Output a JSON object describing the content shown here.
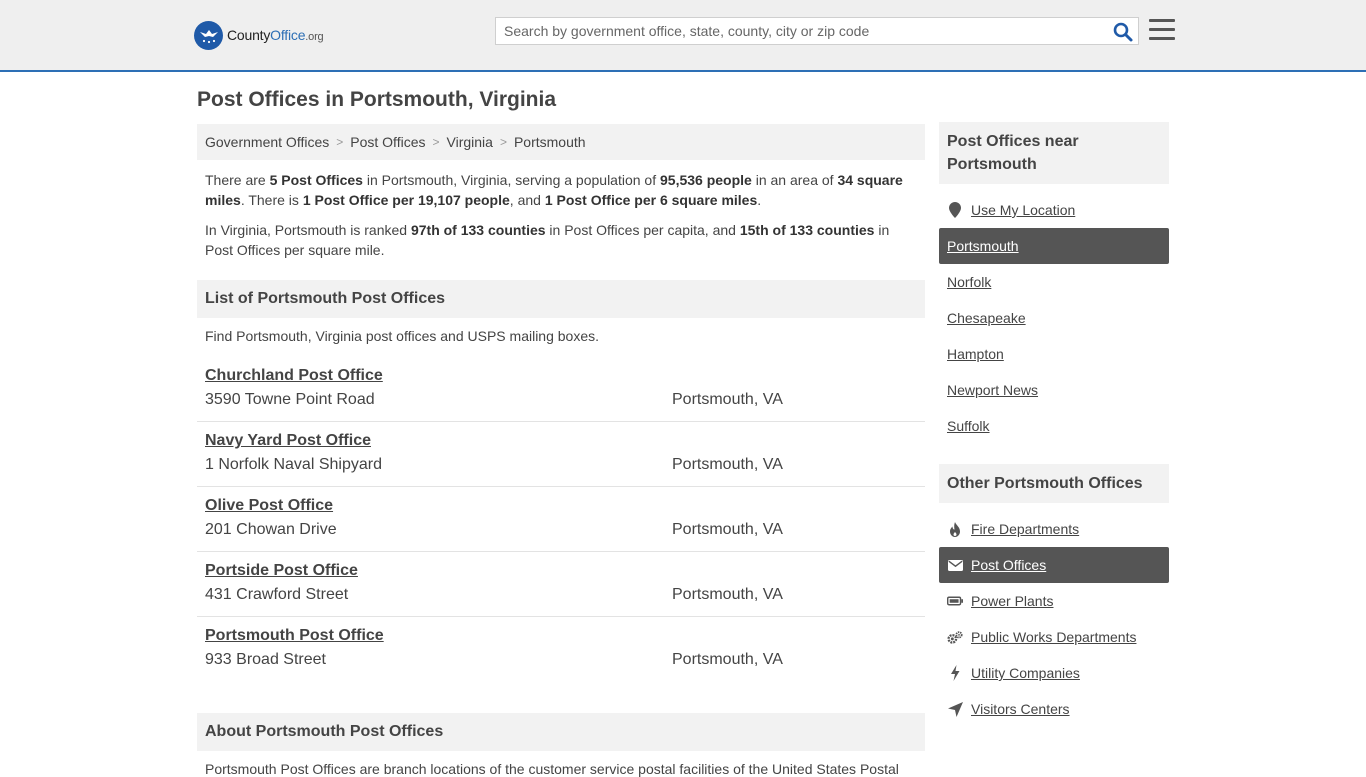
{
  "header": {
    "logo": {
      "part1": "County",
      "part2": "Office",
      "part3": ".org"
    },
    "search_placeholder": "Search by government office, state, county, city or zip code"
  },
  "main": {
    "title": "Post Offices in Portsmouth, Virginia",
    "breadcrumb": [
      "Government Offices",
      "Post Offices",
      "Virginia",
      "Portsmouth"
    ],
    "breadcrumb_sep": ">",
    "summary1": {
      "t1": "There are ",
      "b1": "5 Post Offices",
      "t2": " in Portsmouth, Virginia, serving a population of ",
      "b2": "95,536 people",
      "t3": " in an area of ",
      "b3": "34 square miles",
      "t4": ". There is ",
      "b4": "1 Post Office per 19,107 people",
      "t5": ", and ",
      "b5": "1 Post Office per 6 square miles",
      "t6": "."
    },
    "summary2": {
      "t1": "In Virginia, Portsmouth is ranked ",
      "b1": "97th of 133 counties",
      "t2": " in Post Offices per capita, and ",
      "b2": "15th of 133 counties",
      "t3": " in Post Offices per square mile."
    },
    "list_heading": "List of Portsmouth Post Offices",
    "list_intro": "Find Portsmouth, Virginia post offices and USPS mailing boxes.",
    "post_offices": [
      {
        "name": "Churchland Post Office",
        "address": "3590 Towne Point Road",
        "city": "Portsmouth, VA"
      },
      {
        "name": "Navy Yard Post Office",
        "address": "1 Norfolk Naval Shipyard",
        "city": "Portsmouth, VA"
      },
      {
        "name": "Olive Post Office",
        "address": "201 Chowan Drive",
        "city": "Portsmouth, VA"
      },
      {
        "name": "Portside Post Office",
        "address": "431 Crawford Street",
        "city": "Portsmouth, VA"
      },
      {
        "name": "Portsmouth Post Office",
        "address": "933 Broad Street",
        "city": "Portsmouth, VA"
      }
    ],
    "about_heading": "About Portsmouth Post Offices",
    "about_text": "Portsmouth Post Offices are branch locations of the customer service postal facilities of the United States Postal"
  },
  "sidebar": {
    "near_heading": "Post Offices near Portsmouth",
    "near_items": [
      {
        "label": "Use My Location",
        "icon": "location-pin-icon"
      },
      {
        "label": "Portsmouth",
        "active": true
      },
      {
        "label": "Norfolk"
      },
      {
        "label": "Chesapeake"
      },
      {
        "label": "Hampton"
      },
      {
        "label": "Newport News"
      },
      {
        "label": "Suffolk"
      }
    ],
    "other_heading": "Other Portsmouth Offices",
    "other_items": [
      {
        "label": "Fire Departments",
        "icon": "flame-icon"
      },
      {
        "label": "Post Offices",
        "icon": "envelope-icon",
        "active": true
      },
      {
        "label": "Power Plants",
        "icon": "battery-icon"
      },
      {
        "label": "Public Works Departments",
        "icon": "gears-icon"
      },
      {
        "label": "Utility Companies",
        "icon": "lightning-bolt-icon"
      },
      {
        "label": "Visitors Centers",
        "icon": "location-arrow-icon"
      }
    ]
  },
  "colors": {
    "accent": "#2d6fb5",
    "active_bg": "#555555",
    "panel_bg": "#f2f2f2"
  }
}
